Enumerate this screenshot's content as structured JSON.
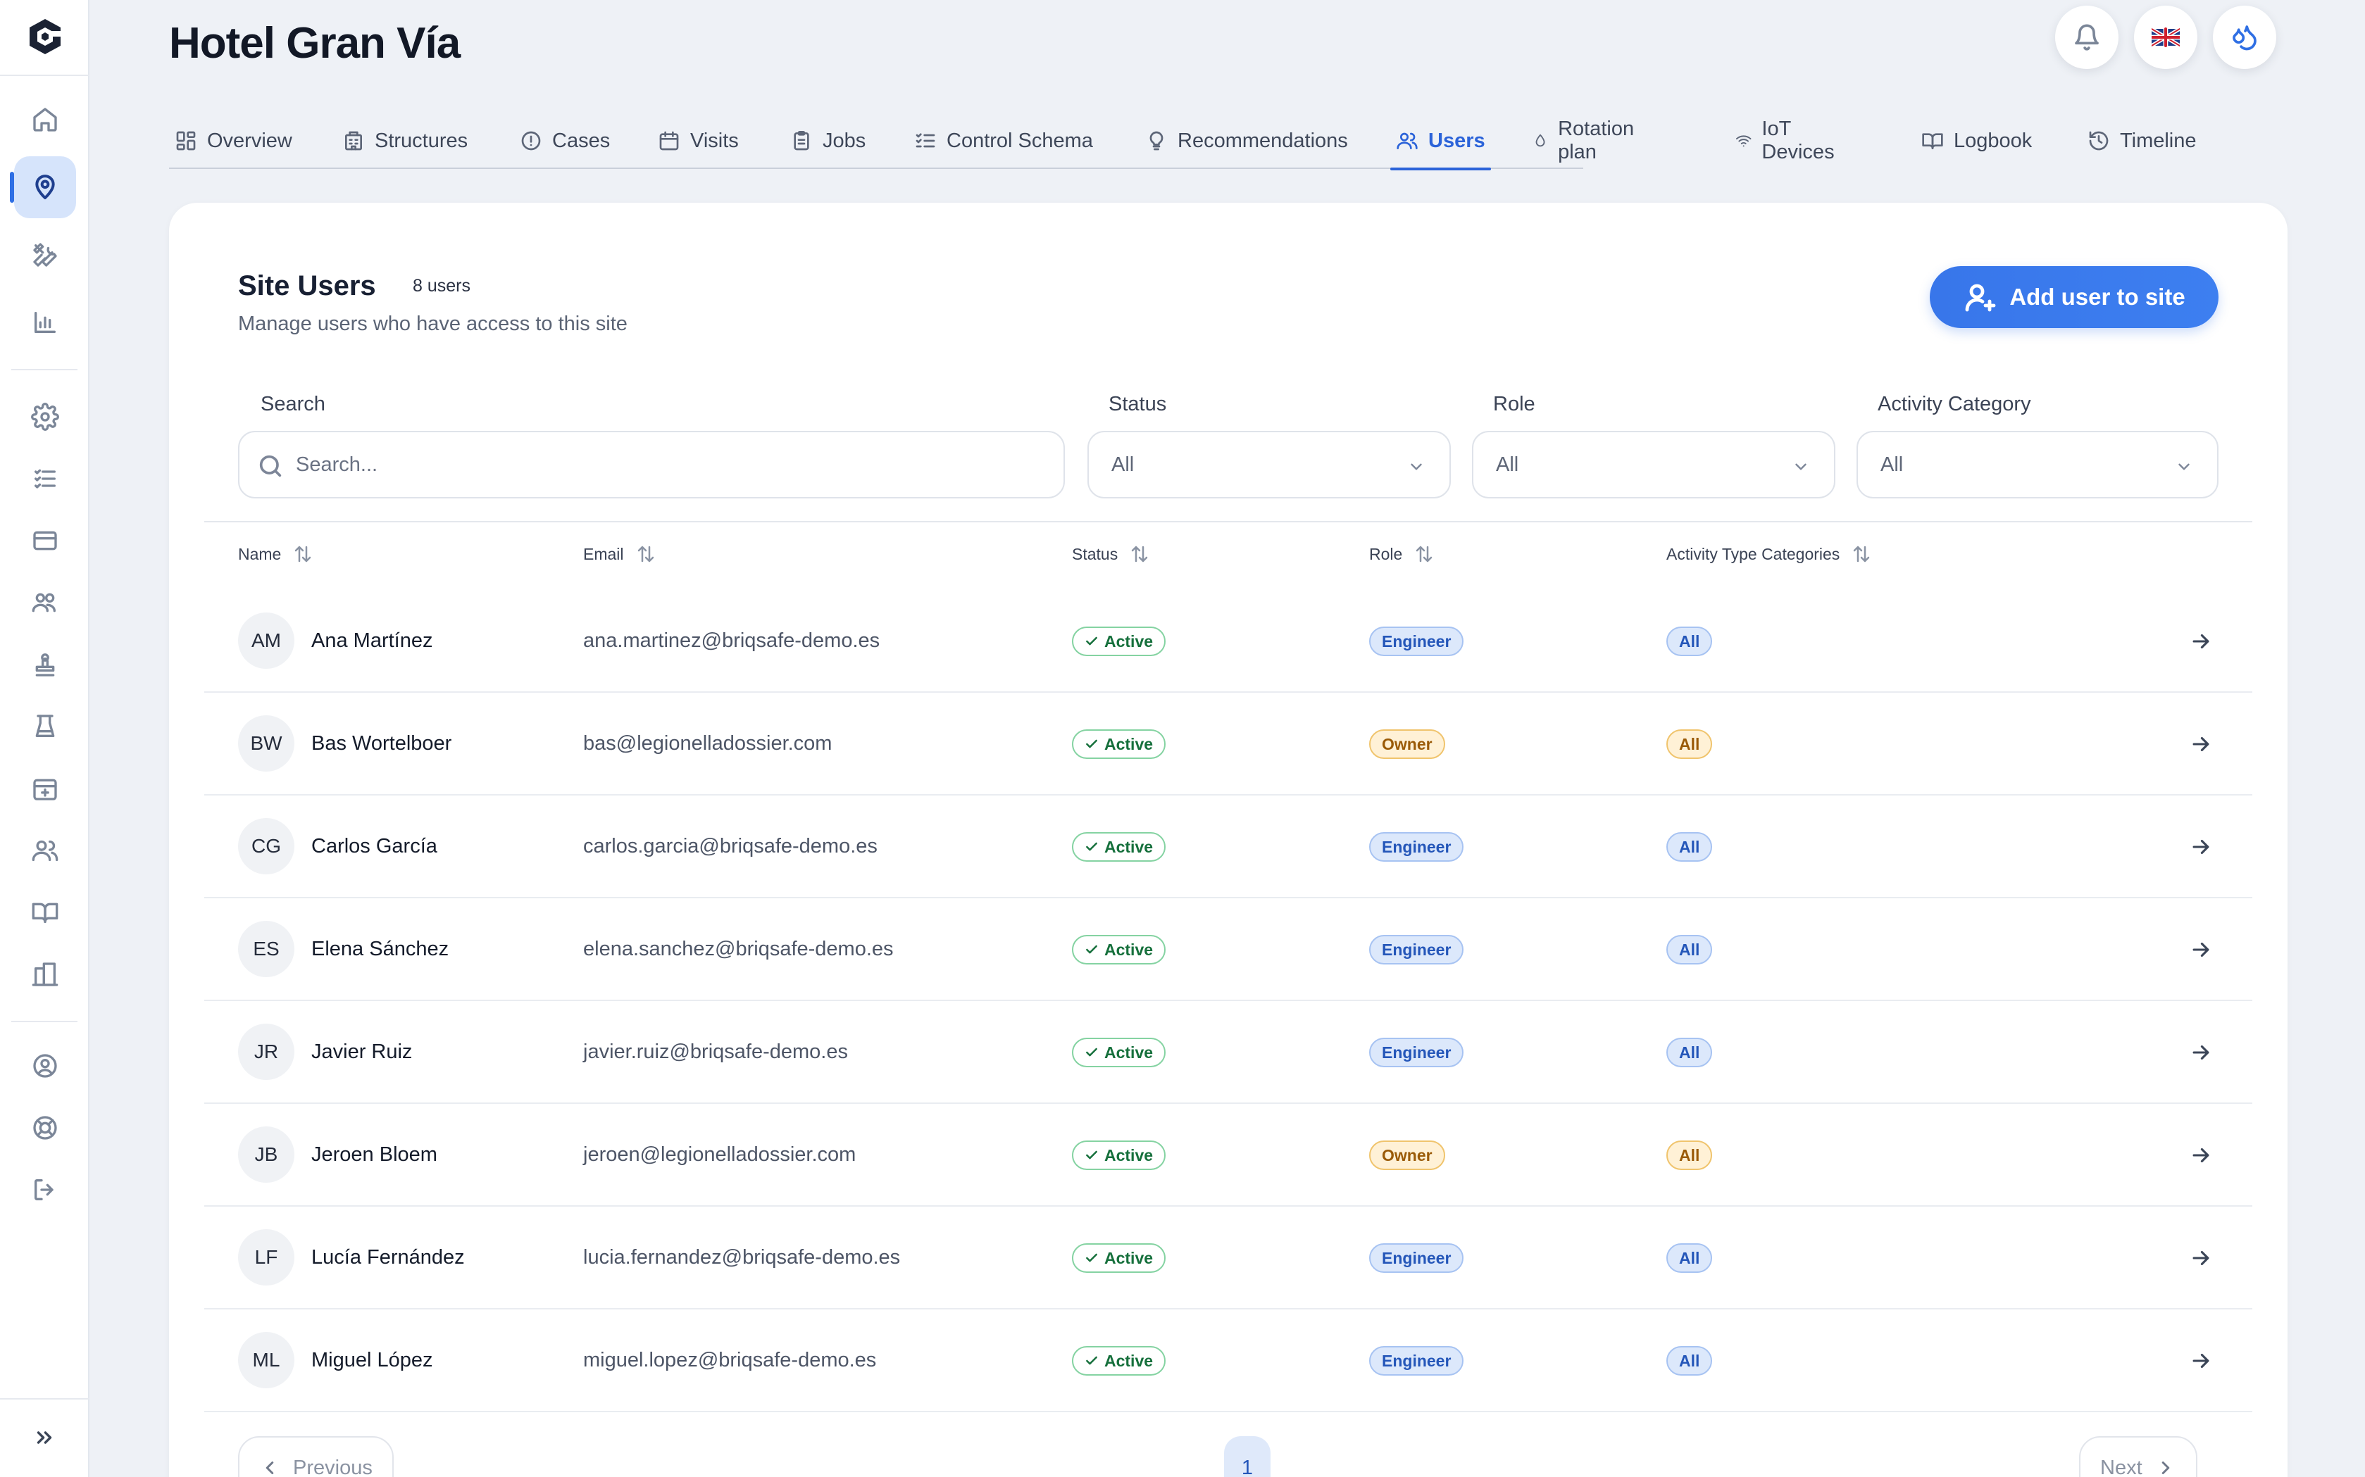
{
  "header": {
    "title": "Hotel Gran Vía"
  },
  "tabs": [
    {
      "label": "Overview",
      "icon": "grid-icon"
    },
    {
      "label": "Structures",
      "icon": "building-icon"
    },
    {
      "label": "Cases",
      "icon": "alert-circle-icon"
    },
    {
      "label": "Visits",
      "icon": "calendar-icon"
    },
    {
      "label": "Jobs",
      "icon": "clipboard-icon"
    },
    {
      "label": "Control Schema",
      "icon": "checklist-icon"
    },
    {
      "label": "Recommendations",
      "icon": "lightbulb-icon"
    },
    {
      "label": "Users",
      "icon": "users-icon",
      "active": true
    },
    {
      "label": "Rotation plan",
      "icon": "droplet-icon"
    },
    {
      "label": "IoT Devices",
      "icon": "wifi-icon"
    },
    {
      "label": "Logbook",
      "icon": "book-open-icon"
    },
    {
      "label": "Timeline",
      "icon": "history-icon"
    }
  ],
  "card": {
    "title": "Site Users",
    "count": "8 users",
    "subtitle": "Manage users who have access to this site",
    "add_button": "Add user to site"
  },
  "filters": {
    "search_label": "Search",
    "search_placeholder": "Search...",
    "status_label": "Status",
    "status_value": "All",
    "role_label": "Role",
    "role_value": "All",
    "category_label": "Activity Category",
    "category_value": "All"
  },
  "table": {
    "columns": [
      "Name",
      "Email",
      "Status",
      "Role",
      "Activity Type Categories"
    ],
    "rows": [
      {
        "initials": "AM",
        "name": "Ana Martínez",
        "email": "ana.martinez@briqsafe-demo.es",
        "status": "Active",
        "role": "Engineer",
        "category": "All"
      },
      {
        "initials": "BW",
        "name": "Bas Wortelboer",
        "email": "bas@legionelladossier.com",
        "status": "Active",
        "role": "Owner",
        "category": "All"
      },
      {
        "initials": "CG",
        "name": "Carlos García",
        "email": "carlos.garcia@briqsafe-demo.es",
        "status": "Active",
        "role": "Engineer",
        "category": "All"
      },
      {
        "initials": "ES",
        "name": "Elena Sánchez",
        "email": "elena.sanchez@briqsafe-demo.es",
        "status": "Active",
        "role": "Engineer",
        "category": "All"
      },
      {
        "initials": "JR",
        "name": "Javier Ruiz",
        "email": "javier.ruiz@briqsafe-demo.es",
        "status": "Active",
        "role": "Engineer",
        "category": "All"
      },
      {
        "initials": "JB",
        "name": "Jeroen Bloem",
        "email": "jeroen@legionelladossier.com",
        "status": "Active",
        "role": "Owner",
        "category": "All"
      },
      {
        "initials": "LF",
        "name": "Lucía Fernández",
        "email": "lucia.fernandez@briqsafe-demo.es",
        "status": "Active",
        "role": "Engineer",
        "category": "All"
      },
      {
        "initials": "ML",
        "name": "Miguel López",
        "email": "miguel.lopez@briqsafe-demo.es",
        "status": "Active",
        "role": "Engineer",
        "category": "All"
      }
    ]
  },
  "pagination": {
    "previous": "Previous",
    "page": "1",
    "next": "Next"
  },
  "colors": {
    "accent": "#2b63d9",
    "engineer_badge": "#dce8fb",
    "owner_badge": "#fff1d6",
    "active_badge": "#16703c"
  }
}
